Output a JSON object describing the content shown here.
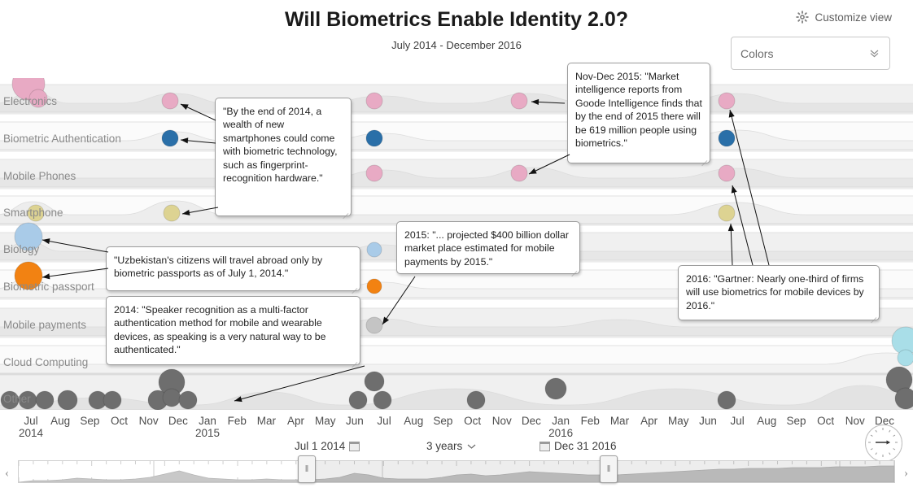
{
  "header": {
    "title": "Will Biometrics Enable Identity 2.0?",
    "subtitle": "July 2014 - December 2016",
    "customize_label": "Customize view",
    "gear_icon": "gear-icon"
  },
  "colors_select": {
    "value": "Colors",
    "chevron_icon": "chevron-down-icon"
  },
  "rows": [
    {
      "label": "Electronics",
      "color": "#e8aac4"
    },
    {
      "label": "Biometric Authentication",
      "color": "#2a6fa8"
    },
    {
      "label": "Mobile Phones",
      "color": "#e8aac4"
    },
    {
      "label": "Smartphone",
      "color": "#ddd392"
    },
    {
      "label": "Biology",
      "color": "#a9cbe8"
    },
    {
      "label": "Biometric passport",
      "color": "#f28212"
    },
    {
      "label": "Mobile payments",
      "color": "#c4c4c4"
    },
    {
      "label": "Cloud Computing",
      "color": "#a9dee8"
    },
    {
      "label": "Other",
      "color": "#6e6e6e"
    }
  ],
  "x_axis": {
    "ticks": [
      {
        "month": "Jul",
        "year": "2014"
      },
      {
        "month": "Aug",
        "year": ""
      },
      {
        "month": "Sep",
        "year": ""
      },
      {
        "month": "Oct",
        "year": ""
      },
      {
        "month": "Nov",
        "year": ""
      },
      {
        "month": "Dec",
        "year": ""
      },
      {
        "month": "Jan",
        "year": "2015"
      },
      {
        "month": "Feb",
        "year": ""
      },
      {
        "month": "Mar",
        "year": ""
      },
      {
        "month": "Apr",
        "year": ""
      },
      {
        "month": "May",
        "year": ""
      },
      {
        "month": "Jun",
        "year": ""
      },
      {
        "month": "Jul",
        "year": ""
      },
      {
        "month": "Aug",
        "year": ""
      },
      {
        "month": "Sep",
        "year": ""
      },
      {
        "month": "Oct",
        "year": ""
      },
      {
        "month": "Nov",
        "year": ""
      },
      {
        "month": "Dec",
        "year": ""
      },
      {
        "month": "Jan",
        "year": "2016"
      },
      {
        "month": "Feb",
        "year": ""
      },
      {
        "month": "Mar",
        "year": ""
      },
      {
        "month": "Apr",
        "year": ""
      },
      {
        "month": "May",
        "year": ""
      },
      {
        "month": "Jun",
        "year": ""
      },
      {
        "month": "Jul",
        "year": ""
      },
      {
        "month": "Aug",
        "year": ""
      },
      {
        "month": "Sep",
        "year": ""
      },
      {
        "month": "Oct",
        "year": ""
      },
      {
        "month": "Nov",
        "year": ""
      },
      {
        "month": "Dec",
        "year": ""
      }
    ]
  },
  "range_controls": {
    "start_date": "Jul 1 2014",
    "end_date": "Dec 31 2016",
    "span": "3 years",
    "span_chevron_icon": "chevron-down-icon",
    "calendar_icon": "calendar-icon",
    "clock_icon": "clock-icon",
    "prev_icon": "chevron-left-icon",
    "next_icon": "chevron-right-icon",
    "left_handle_icon": "slider-handle-icon",
    "right_handle_icon": "slider-handle-icon"
  },
  "notes": [
    {
      "id": "note-2014-smartphones",
      "text": "\"By the end of 2014, a wealth of new smartphones could come with biometric technology, such as fingerprint-recognition hardware.\""
    },
    {
      "id": "note-nov-dec-2015",
      "text": "Nov-Dec 2015: \"Market intelligence reports from Goode Intelligence finds that by the end of 2015 there will be 619 million people using biometrics.\""
    },
    {
      "id": "note-uzbekistan",
      "text": "\"Uzbekistan's citizens will travel abroad only by biometric passports as of July 1, 2014.\""
    },
    {
      "id": "note-2015-mobile-payments",
      "text": "2015: \"... projected $400 billion dollar market place estimated for mobile payments by 2015.\""
    },
    {
      "id": "note-2014-speaker-recognition",
      "text": "2014: \"Speaker recognition as a multi-factor authentication method for mobile and wearable devices, as speaking is a very natural way to be authenticated.\""
    },
    {
      "id": "note-2016-gartner",
      "text": "2016: \"Gartner: Nearly one-third of firms will use biometrics for mobile devices by 2016.\""
    }
  ],
  "chart_data": {
    "type": "scatter",
    "title": "Will Biometrics Enable Identity 2.0?",
    "subtitle": "July 2014 - December 2016",
    "xlabel": "",
    "ylabel": "",
    "x_range": [
      "Jul 2014",
      "Dec 2016"
    ],
    "grid": false,
    "legend": "none",
    "series": [
      {
        "name": "Electronics",
        "color": "#e8aac4",
        "row": 0,
        "points": [
          {
            "x": 35,
            "y": 103,
            "r": 20
          },
          {
            "x": 47,
            "y": 121,
            "r": 11
          },
          {
            "x": 209,
            "y": 124,
            "r": 10
          },
          {
            "x": 460,
            "y": 124,
            "r": 10
          },
          {
            "x": 638,
            "y": 124,
            "r": 10
          },
          {
            "x": 893,
            "y": 124,
            "r": 10
          }
        ]
      },
      {
        "name": "Biometric Authentication",
        "color": "#2a6fa8",
        "row": 1,
        "points": [
          {
            "x": 209,
            "y": 170,
            "r": 10
          },
          {
            "x": 460,
            "y": 170,
            "r": 10
          },
          {
            "x": 893,
            "y": 170,
            "r": 10
          }
        ]
      },
      {
        "name": "Mobile Phones",
        "color": "#e8aac4",
        "row": 2,
        "points": [
          {
            "x": 460,
            "y": 213,
            "r": 10
          },
          {
            "x": 638,
            "y": 213,
            "r": 10
          },
          {
            "x": 893,
            "y": 213,
            "r": 10
          }
        ]
      },
      {
        "name": "Smartphone",
        "color": "#ddd392",
        "row": 3,
        "points": [
          {
            "x": 44,
            "y": 262,
            "r": 10
          },
          {
            "x": 211,
            "y": 262,
            "r": 10
          },
          {
            "x": 893,
            "y": 262,
            "r": 10
          }
        ]
      },
      {
        "name": "Biology",
        "color": "#a9cbe8",
        "row": 4,
        "points": [
          {
            "x": 35,
            "y": 291,
            "r": 17
          },
          {
            "x": 460,
            "y": 307,
            "r": 9
          }
        ]
      },
      {
        "name": "Biometric passport",
        "color": "#f28212",
        "row": 5,
        "points": [
          {
            "x": 35,
            "y": 339,
            "r": 17
          },
          {
            "x": 460,
            "y": 352,
            "r": 9
          }
        ]
      },
      {
        "name": "Mobile payments",
        "color": "#c4c4c4",
        "row": 6,
        "points": [
          {
            "x": 460,
            "y": 400,
            "r": 10
          }
        ]
      },
      {
        "name": "Cloud Computing",
        "color": "#a9dee8",
        "row": 7,
        "points": [
          {
            "x": 1113,
            "y": 419,
            "r": 17
          },
          {
            "x": 1113,
            "y": 440,
            "r": 10
          }
        ]
      },
      {
        "name": "Other",
        "color": "#6e6e6e",
        "row": 8,
        "points": [
          {
            "x": 12,
            "y": 492,
            "r": 11
          },
          {
            "x": 34,
            "y": 492,
            "r": 11
          },
          {
            "x": 55,
            "y": 492,
            "r": 11
          },
          {
            "x": 83,
            "y": 492,
            "r": 12
          },
          {
            "x": 120,
            "y": 492,
            "r": 11
          },
          {
            "x": 138,
            "y": 492,
            "r": 11
          },
          {
            "x": 194,
            "y": 492,
            "r": 12
          },
          {
            "x": 211,
            "y": 470,
            "r": 16
          },
          {
            "x": 211,
            "y": 489,
            "r": 11
          },
          {
            "x": 231,
            "y": 492,
            "r": 11
          },
          {
            "x": 440,
            "y": 492,
            "r": 11
          },
          {
            "x": 460,
            "y": 469,
            "r": 12
          },
          {
            "x": 470,
            "y": 492,
            "r": 11
          },
          {
            "x": 585,
            "y": 492,
            "r": 11
          },
          {
            "x": 683,
            "y": 478,
            "r": 13
          },
          {
            "x": 893,
            "y": 492,
            "r": 11
          },
          {
            "x": 1105,
            "y": 467,
            "r": 16
          },
          {
            "x": 1113,
            "y": 490,
            "r": 13
          }
        ]
      }
    ]
  }
}
